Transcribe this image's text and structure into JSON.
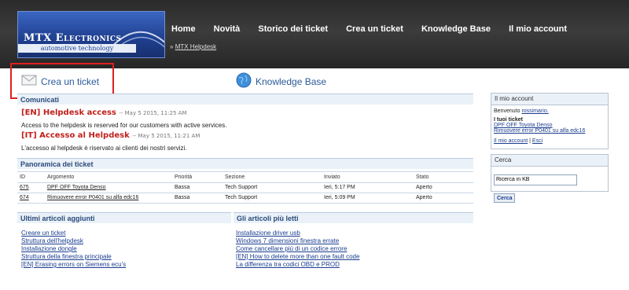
{
  "logo": {
    "title": "MTX Electronics",
    "subtitle": "automotive technology"
  },
  "nav": [
    "Home",
    "Novità",
    "Storico dei ticket",
    "Crea un ticket",
    "Knowledge Base",
    "Il mio account"
  ],
  "breadcrumb": {
    "sep": "»",
    "link": "MTX Helpdesk"
  },
  "quick_links": {
    "create": "Crea un ticket",
    "kb": "Knowledge Base"
  },
  "announcements": {
    "heading": "Comunicati",
    "items": [
      {
        "title": "[EN] Helpdesk access",
        "date": "-- May 5 2015, 11:25 AM",
        "text": "Access to the helpdesk is reserved for our customers with active services."
      },
      {
        "title": "[IT] Accesso al Helpdesk",
        "date": "-- May 5 2015, 11:21 AM",
        "text": "L'accesso al helpdesk è riservato ai clienti dei nostri servizi."
      }
    ]
  },
  "tickets": {
    "heading": "Panoramica dei ticket",
    "columns": [
      "ID",
      "Argomento",
      "Priorità",
      "Sezione",
      "Inviato",
      "Stato"
    ],
    "rows": [
      [
        "675",
        "DPF OFF Toyota Denso",
        "Bassa",
        "Tech Support",
        "Ieri, 5:17 PM",
        "Aperto"
      ],
      [
        "674",
        "Rimuovere error P0401 su alfa edc16",
        "Bassa",
        "Tech Support",
        "Ieri, 5:09 PM",
        "Aperto"
      ]
    ]
  },
  "latest_articles": {
    "heading": "Ultimi articoli aggiunti",
    "items": [
      "Creare un ticket",
      "Struttura dell'helpdesk",
      "Installazione dongle",
      "Struttura della finestra principale",
      "[EN] Erasing errors on Siemens ecu's"
    ]
  },
  "top_articles": {
    "heading": "Gli articoli più letti",
    "items": [
      "Installazione driver usb",
      "Windows 7 dimensioni finestra errate",
      "Come cancellare più di un codice errore",
      "[EN] How to delete more than one fault code",
      "La differenza tra codici OBD e PROD"
    ]
  },
  "account_box": {
    "heading": "Il mio account",
    "welcome": "Benvenuto",
    "user": "rossimario.",
    "tickets_label": "I tuoi ticket",
    "tickets": [
      "DPF OFF Toyota Denso",
      "Rimuovere error P0401 su alfa edc16"
    ],
    "my_account": "Il mio account",
    "sep": "|",
    "logout": "Esci"
  },
  "search_box": {
    "heading": "Cerca",
    "placeholder": "Ricerca in KB",
    "button": "Cerca"
  },
  "colors": {
    "header": "#2e2e2e",
    "accent_red": "#c0201c",
    "link": "#1a3d8f",
    "panel": "#eaf1f8"
  }
}
